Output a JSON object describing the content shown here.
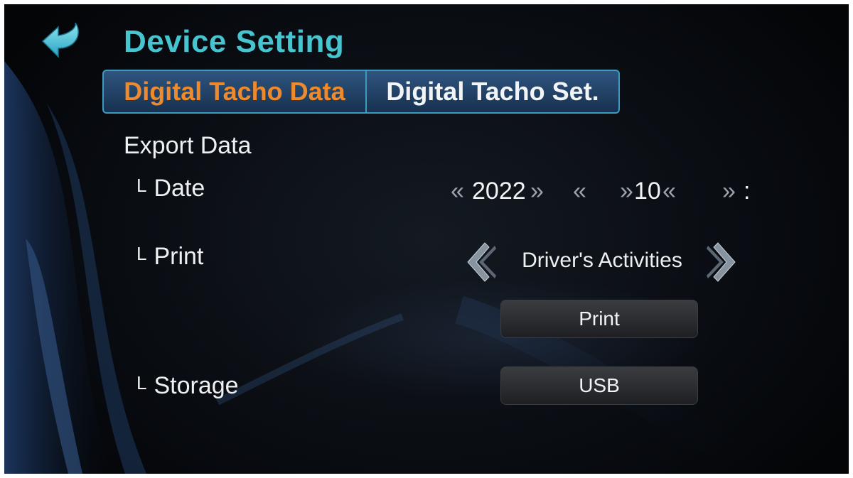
{
  "header": {
    "title": "Device Setting",
    "back_icon": "back-arrow-icon"
  },
  "tabs": [
    {
      "label": "Digital Tacho Data",
      "active": true
    },
    {
      "label": "Digital Tacho Set.",
      "active": false
    }
  ],
  "section": {
    "title": "Export Data",
    "corner_glyph": "L"
  },
  "date": {
    "label": "Date",
    "year": "2022",
    "month": "",
    "day": "10",
    "day_partial": "",
    "extra": ":"
  },
  "print": {
    "label": "Print",
    "value": "Driver's Activities",
    "button_label": "Print"
  },
  "storage": {
    "label": "Storage",
    "button_label": "USB"
  },
  "colors": {
    "title": "#46c4cf",
    "active_tab": "#ee8a2c",
    "tab_border": "#3e9bc0",
    "background": "#080b10"
  }
}
